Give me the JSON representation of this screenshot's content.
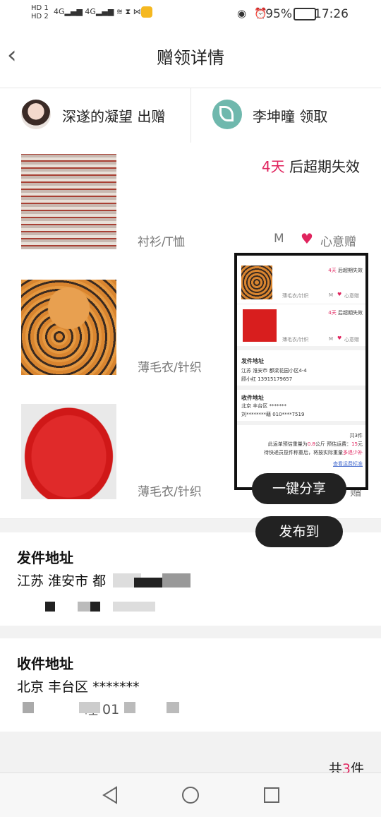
{
  "status_bar": {
    "sim1": "HD 1",
    "sim2": "HD 2",
    "network": "4G",
    "battery": "95%",
    "time": "17:26"
  },
  "header": {
    "back_icon": "chevron-left-icon",
    "title": "赠领详情"
  },
  "people": {
    "donor": "深遂的凝望 出赠",
    "receiver": "李坤曈 领取"
  },
  "items": [
    {
      "category": "衬衫/T恤",
      "size": "M",
      "gift": "心意赠",
      "expire_num": "4天",
      "expire_text": " 后超期失效"
    },
    {
      "category": "薄毛衣/针织"
    },
    {
      "category": "薄毛衣/针织",
      "gift_partial": "赠"
    }
  ],
  "sender": {
    "title": "发件地址",
    "line1": "江苏 淮安市 都"
  },
  "receiver_addr": {
    "title": "收件地址",
    "line1": "北京 丰台区 *******",
    "line2_partial": "瞳 01"
  },
  "total": {
    "prefix": "共",
    "count": "3",
    "suffix": "件"
  },
  "share": {
    "one_click": "一键分享",
    "publish": "发布到"
  },
  "preview": {
    "item1": {
      "expire_num": "4天",
      "expire_text": " 后超期失效",
      "category": "薄毛衣/针织",
      "size": "M",
      "gift": "心意赠"
    },
    "item2": {
      "expire_num": "4天",
      "expire_text": " 后超期失效",
      "category": "薄毛衣/针织",
      "size": "M",
      "gift": "心意赠"
    },
    "sender_title": "发件地址",
    "sender_line1": "江苏 淮安市 都梁花园小区4-4",
    "sender_line2": "顾小红 13915179657",
    "receiver_title": "收件地址",
    "receiver_line1": "北京 丰台区 *******",
    "receiver_line2": "刘********藉 010****7519",
    "total": "共3件",
    "weight_prefix": "此运单预估重量为",
    "weight_val": "0.8",
    "weight_unit": "公斤",
    "fee_prefix": "  预估运费：",
    "fee_val": "15",
    "fee_unit": "元",
    "note_prefix": "待快递员揽件称重后，将按实际重量",
    "note_link": "多退少补",
    "rules_link": "查看运费标准"
  },
  "colors": {
    "accent": "#e0245e",
    "overlay_button": "#222222"
  }
}
